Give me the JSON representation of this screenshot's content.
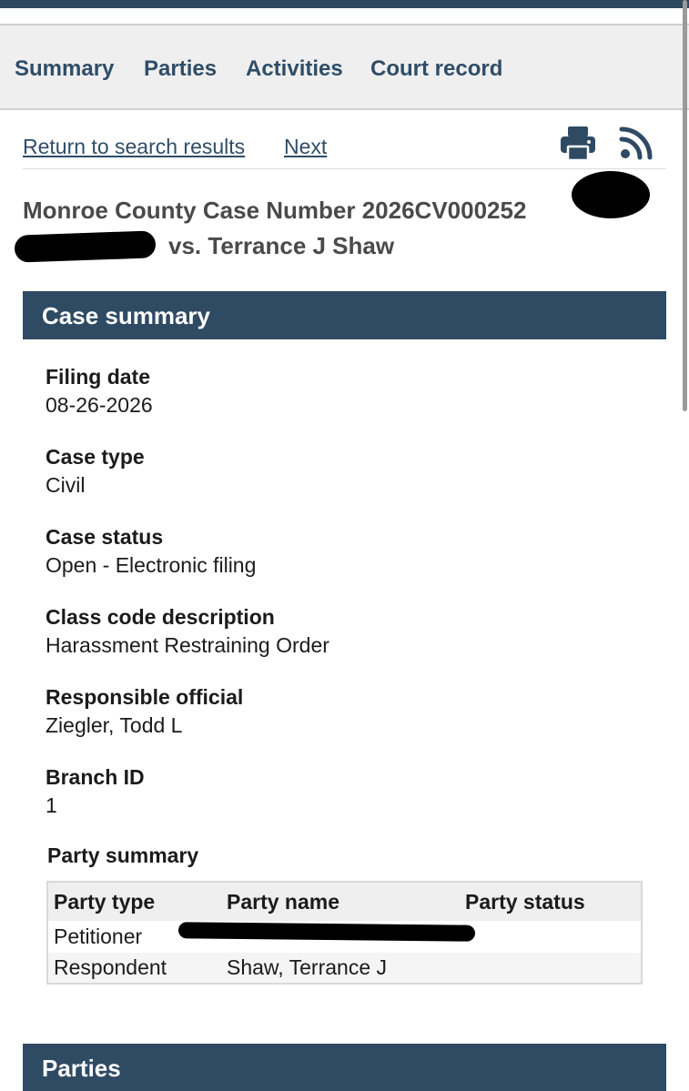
{
  "nav": {
    "tabs": [
      "Summary",
      "Parties",
      "Activities",
      "Court record"
    ]
  },
  "toolbar": {
    "return_link": "Return to search results",
    "next_link": "Next",
    "print_icon": "print-icon",
    "rss_icon": "rss-icon"
  },
  "case": {
    "title_line1": "Monroe County Case Number 2026CV000252",
    "title_line2": "vs. Terrance J Shaw"
  },
  "case_summary": {
    "header": "Case summary",
    "fields": [
      {
        "label": "Filing date",
        "value": "08-26-2026"
      },
      {
        "label": "Case type",
        "value": "Civil"
      },
      {
        "label": "Case status",
        "value": "Open - Electronic filing"
      },
      {
        "label": "Class code description",
        "value": "Harassment Restraining Order"
      },
      {
        "label": "Responsible official",
        "value": "Ziegler, Todd L"
      },
      {
        "label": "Branch ID",
        "value": "1"
      }
    ]
  },
  "party_summary": {
    "heading": "Party summary",
    "columns": [
      "Party type",
      "Party name",
      "Party status"
    ],
    "rows": [
      {
        "type": "Petitioner",
        "name": "",
        "status": ""
      },
      {
        "type": "Respondent",
        "name": "Shaw, Terrance J",
        "status": ""
      }
    ]
  },
  "parties_section": {
    "header": "Parties"
  },
  "colors": {
    "accent": "#2f4a63",
    "link": "#2f4d68"
  }
}
